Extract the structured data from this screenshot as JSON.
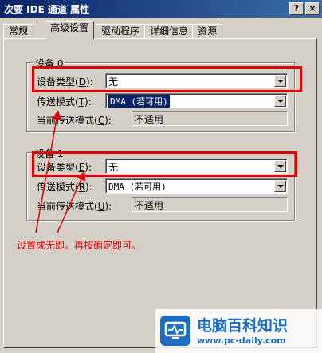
{
  "window": {
    "title": "次要 IDE 通道 属性",
    "help_button": "?",
    "close_button": "×"
  },
  "tabs": [
    {
      "label": "常规",
      "active": false
    },
    {
      "label": "高级设置",
      "active": true
    },
    {
      "label": "驱动程序",
      "active": false
    },
    {
      "label": "详细信息",
      "active": false
    },
    {
      "label": "资源",
      "active": false
    }
  ],
  "device0": {
    "group_title": "设备 0",
    "type_label": "设备类型",
    "type_key": "D",
    "type_value": "无",
    "transfer_label": "传送模式",
    "transfer_key": "T",
    "transfer_value": "DMA (若可用)",
    "current_label": "当前传送模式",
    "current_key": "C",
    "current_value": "不适用"
  },
  "device1": {
    "group_title": "设备 1",
    "type_label": "设备类型",
    "type_key": "E",
    "type_value": "无",
    "transfer_label": "传送模式",
    "transfer_key": "R",
    "transfer_value": "DMA (若可用)",
    "current_label": "当前传送模式",
    "current_key": "U",
    "current_value": "不适用"
  },
  "annotation": {
    "text": "设置成无即。再按确定即可。",
    "color": "#e00000"
  },
  "watermark": {
    "title": "电脑百科知识",
    "url": "www.pc-daily.com"
  }
}
